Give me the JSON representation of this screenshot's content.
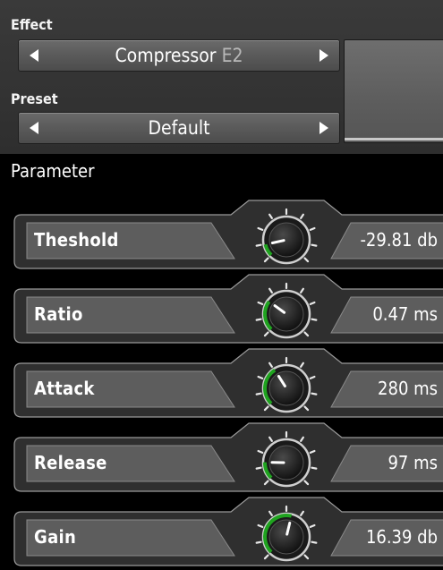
{
  "effect": {
    "label": "Effect",
    "name": "Compressor",
    "variant": "E2"
  },
  "preset": {
    "label": "Preset",
    "name": "Default"
  },
  "parameters_title": "Parameter",
  "parameters": [
    {
      "name": "Theshold",
      "value": "-29.81 db",
      "level": 0.12
    },
    {
      "name": "Ratio",
      "value": "0.47 ms",
      "level": 0.3
    },
    {
      "name": "Attack",
      "value": "280 ms",
      "level": 0.38
    },
    {
      "name": "Release",
      "value": "97 ms",
      "level": 0.17
    },
    {
      "name": "Gain",
      "value": "16.39 db",
      "level": 0.55
    }
  ],
  "colors": {
    "knob_arc": "#1fa31f",
    "panel": "#333333",
    "field": "#5c5c5c"
  }
}
